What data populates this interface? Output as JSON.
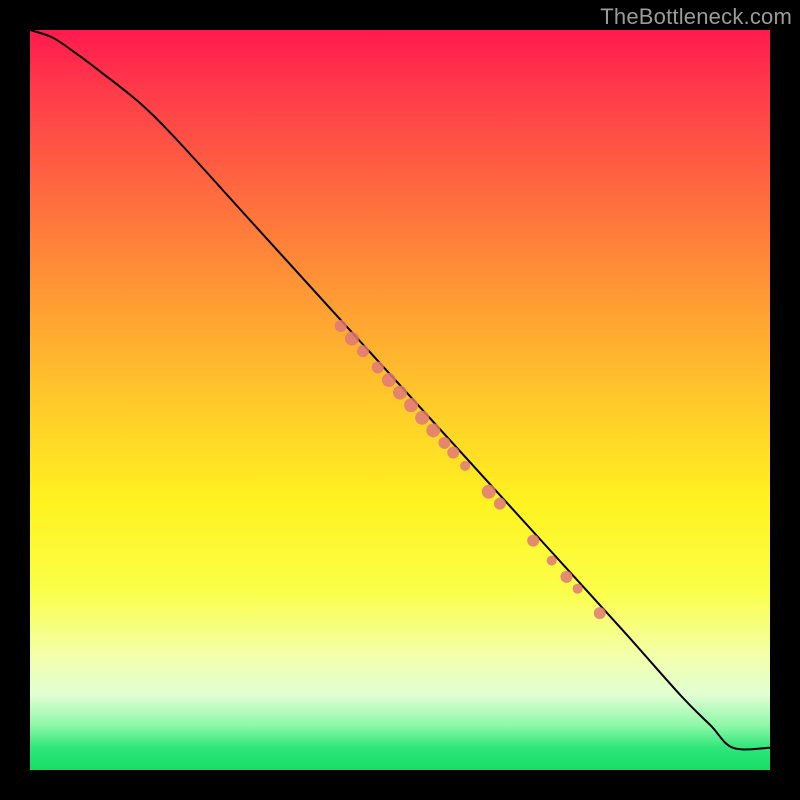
{
  "watermark": "TheBottleneck.com",
  "chart_data": {
    "type": "line",
    "title": "",
    "xlabel": "",
    "ylabel": "",
    "xlim": [
      0,
      100
    ],
    "ylim": [
      0,
      100
    ],
    "grid": false,
    "legend": false,
    "series": [
      {
        "name": "curve",
        "x": [
          0,
          3,
          6,
          10,
          15,
          20,
          30,
          40,
          50,
          60,
          70,
          80,
          88,
          92,
          95,
          100
        ],
        "y": [
          100,
          99,
          97,
          94,
          90,
          85,
          74,
          63,
          52,
          41,
          30,
          19,
          10,
          6,
          3,
          3
        ],
        "stroke": "#000000",
        "stroke_width": 2
      }
    ],
    "markers": {
      "name": "highlighted-points",
      "color": "#e07878",
      "points": [
        {
          "x": 42,
          "y": 60,
          "r": 6
        },
        {
          "x": 43.5,
          "y": 58.3,
          "r": 7
        },
        {
          "x": 45,
          "y": 56.6,
          "r": 6
        },
        {
          "x": 47,
          "y": 54.4,
          "r": 6
        },
        {
          "x": 48.5,
          "y": 52.7,
          "r": 7
        },
        {
          "x": 50,
          "y": 51,
          "r": 7
        },
        {
          "x": 51.5,
          "y": 49.3,
          "r": 7
        },
        {
          "x": 53,
          "y": 47.6,
          "r": 7
        },
        {
          "x": 54.5,
          "y": 45.9,
          "r": 7
        },
        {
          "x": 56,
          "y": 44.2,
          "r": 6
        },
        {
          "x": 57.2,
          "y": 42.9,
          "r": 6
        },
        {
          "x": 58.8,
          "y": 41.1,
          "r": 5
        },
        {
          "x": 62,
          "y": 37.6,
          "r": 7
        },
        {
          "x": 63.5,
          "y": 36,
          "r": 6
        },
        {
          "x": 68,
          "y": 31,
          "r": 6
        },
        {
          "x": 70.5,
          "y": 28.3,
          "r": 5
        },
        {
          "x": 72.5,
          "y": 26.1,
          "r": 6
        },
        {
          "x": 74,
          "y": 24.5,
          "r": 5
        },
        {
          "x": 77,
          "y": 21.2,
          "r": 6
        }
      ]
    }
  }
}
